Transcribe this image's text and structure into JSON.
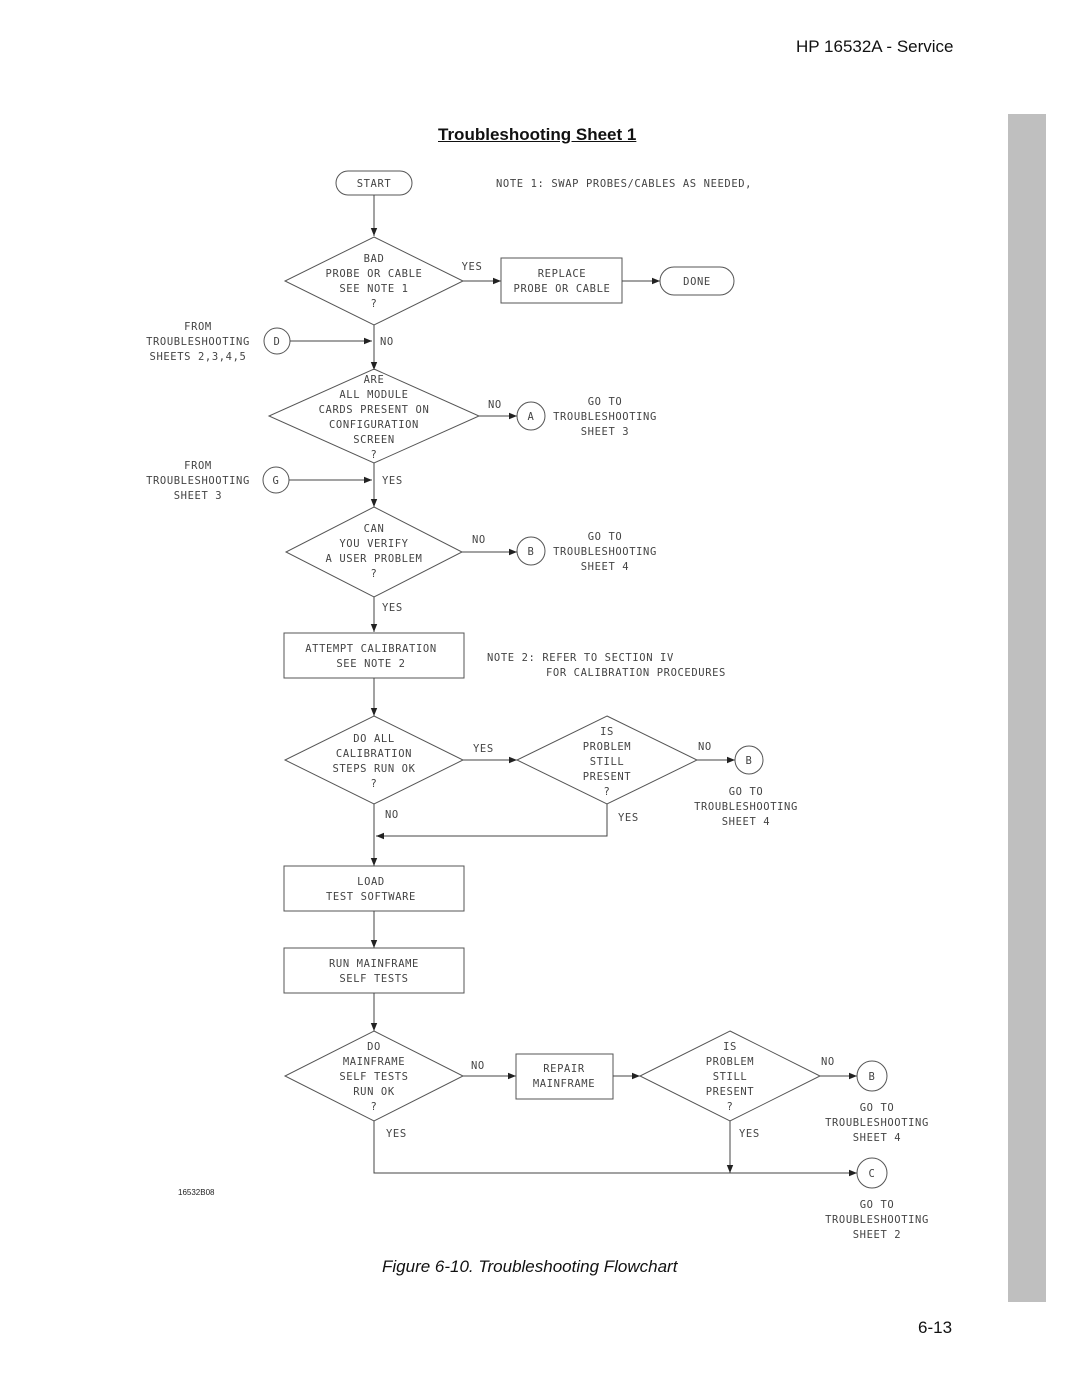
{
  "header": {
    "running_head": "HP 16532A - Service"
  },
  "title": "Troubleshooting Sheet 1",
  "caption": "Figure 6-10.  Troubleshooting Flowchart",
  "page_number": "6-13",
  "figure_id": "16532B08",
  "notes": {
    "note1": "NOTE 1: SWAP PROBES/CABLES AS NEEDED,",
    "note2_line1": "NOTE 2: REFER TO SECTION IV",
    "note2_line2": "FOR CALIBRATION PROCEDURES"
  },
  "nodes": {
    "start": "START",
    "done": "DONE",
    "d1": [
      "BAD",
      "PROBE OR CABLE",
      "SEE NOTE 1",
      "?"
    ],
    "replace": [
      "REPLACE",
      "PROBE OR CABLE"
    ],
    "d2": [
      "ARE",
      "ALL MODULE",
      "CARDS PRESENT ON",
      "CONFIGURATION",
      "SCREEN",
      "?"
    ],
    "d3": [
      "CAN",
      "YOU VERIFY",
      "A USER PROBLEM",
      "?"
    ],
    "calib": [
      "ATTEMPT CALIBRATION",
      "SEE NOTE 2"
    ],
    "d4": [
      "DO ALL",
      "CALIBRATION",
      "STEPS RUN OK",
      "?"
    ],
    "d5": [
      "IS",
      "PROBLEM",
      "STILL",
      "PRESENT",
      "?"
    ],
    "load": [
      "LOAD",
      "TEST SOFTWARE"
    ],
    "selftest": [
      "RUN MAINFRAME",
      "SELF TESTS"
    ],
    "d6": [
      "DO",
      "MAINFRAME",
      "SELF TESTS",
      "RUN OK",
      "?"
    ],
    "repair": [
      "REPAIR",
      "MAINFRAME"
    ],
    "d7": [
      "IS",
      "PROBLEM",
      "STILL",
      "PRESENT",
      "?"
    ]
  },
  "connectors": {
    "D": {
      "letter": "D",
      "label": [
        "FROM",
        "TROUBLESHOOTING",
        "SHEETS 2,3,4,5"
      ]
    },
    "G": {
      "letter": "G",
      "label": [
        "FROM",
        "TROUBLESHOOTING",
        "SHEET 3"
      ]
    },
    "A": {
      "letter": "A",
      "label": [
        "GO TO",
        "TROUBLESHOOTING",
        "SHEET 3"
      ]
    },
    "B1": {
      "letter": "B",
      "label": [
        "GO TO",
        "TROUBLESHOOTING",
        "SHEET 4"
      ]
    },
    "B2": {
      "letter": "B",
      "label": [
        "GO TO",
        "TROUBLESHOOTING",
        "SHEET 4"
      ]
    },
    "B3": {
      "letter": "B",
      "label": [
        "GO TO",
        "TROUBLESHOOTING",
        "SHEET 4"
      ]
    },
    "C": {
      "letter": "C",
      "label": [
        "GO TO",
        "TROUBLESHOOTING",
        "SHEET 2"
      ]
    }
  },
  "edge_labels": {
    "yes": "YES",
    "no": "NO"
  }
}
